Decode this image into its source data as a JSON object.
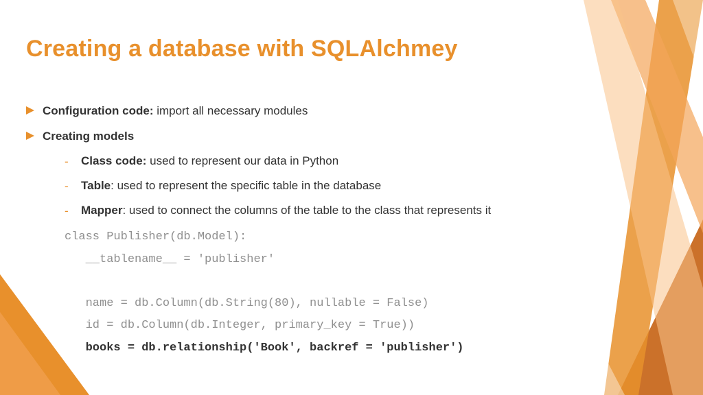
{
  "title": "Creating a database with SQLAlchmey",
  "bullets": [
    {
      "bold": "Configuration code:",
      "rest": " import all necessary modules"
    },
    {
      "bold": "Creating models",
      "rest": ""
    }
  ],
  "subs": [
    {
      "bold": "Class code:",
      "rest": " used to represent our data in Python"
    },
    {
      "bold": "Table",
      "rest": ": used to represent the specific table in the database"
    },
    {
      "bold": "Mapper",
      "rest": ": used to connect the columns of the table to the class that represents it"
    }
  ],
  "code": {
    "l1": "class Publisher(db.Model):",
    "l2": "   __tablename__ = 'publisher'",
    "l3": " ",
    "l4": "   name = db.Column(db.String(80), nullable = False)",
    "l5": "   id = db.Column(db.Integer, primary_key = True))",
    "l6": "   books = db.relationship('Book', backref = 'publisher')"
  },
  "colors": {
    "accent": "#e8902c",
    "dark": "#c8691f",
    "light": "#f9c28b"
  }
}
